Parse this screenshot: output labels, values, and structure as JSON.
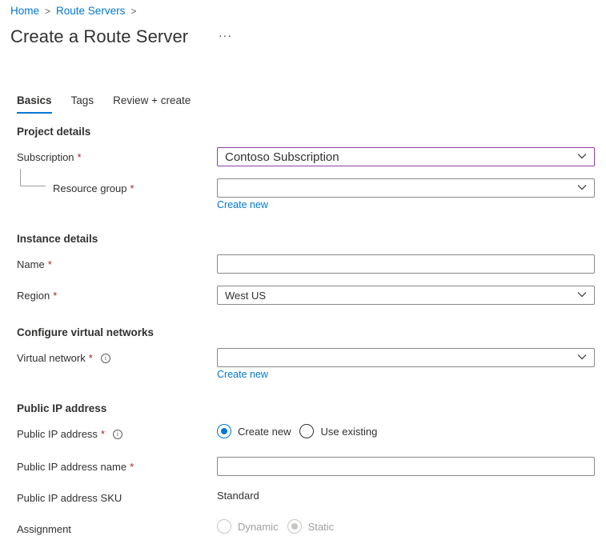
{
  "breadcrumb": {
    "items": [
      "Home",
      "Route Servers"
    ],
    "separator": ">"
  },
  "page": {
    "title": "Create a Route Server",
    "more_label": "···"
  },
  "tabs": [
    {
      "label": "Basics",
      "active": true
    },
    {
      "label": "Tags",
      "active": false
    },
    {
      "label": "Review + create",
      "active": false
    }
  ],
  "sections": {
    "project_details": "Project details",
    "instance_details": "Instance details",
    "virtual_networks": "Configure virtual networks",
    "public_ip": "Public IP address"
  },
  "fields": {
    "subscription": {
      "label": "Subscription",
      "required": "*",
      "value": "Contoso Subscription"
    },
    "resource_group": {
      "label": "Resource group",
      "required": "*",
      "value": "",
      "create_new": "Create new"
    },
    "name": {
      "label": "Name",
      "required": "*",
      "value": ""
    },
    "region": {
      "label": "Region",
      "required": "*",
      "value": "West US"
    },
    "virtual_network": {
      "label": "Virtual network",
      "required": "*",
      "value": "",
      "info": "i",
      "create_new": "Create new"
    },
    "public_ip": {
      "label": "Public IP address",
      "required": "*",
      "info": "i",
      "options": [
        {
          "label": "Create new",
          "checked": true
        },
        {
          "label": "Use existing",
          "checked": false
        }
      ]
    },
    "public_ip_name": {
      "label": "Public IP address name",
      "required": "*",
      "value": ""
    },
    "public_ip_sku": {
      "label": "Public IP address SKU",
      "value": "Standard"
    },
    "assignment": {
      "label": "Assignment",
      "options": [
        {
          "label": "Dynamic",
          "checked": false,
          "disabled": true
        },
        {
          "label": "Static",
          "checked": true,
          "disabled": true
        }
      ]
    }
  },
  "colors": {
    "accent": "#0078d4",
    "required": "#a4262c",
    "focus_border": "#8a3ea8"
  }
}
